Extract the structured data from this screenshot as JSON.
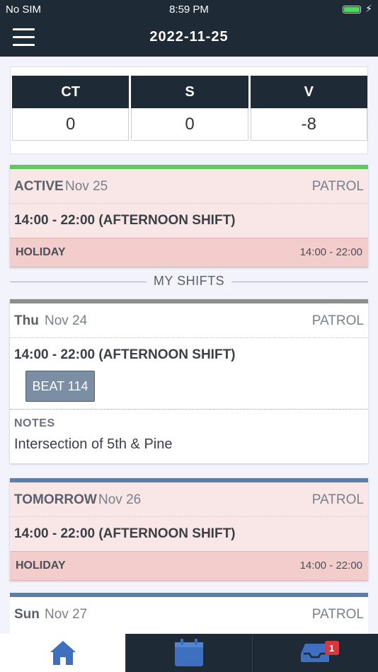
{
  "status_bar": {
    "carrier": "No SIM",
    "time": "8:59 PM"
  },
  "header": {
    "title": "2022-11-25"
  },
  "summary": [
    {
      "label": "CT",
      "value": "0"
    },
    {
      "label": "S",
      "value": "0"
    },
    {
      "label": "V",
      "value": "-8"
    }
  ],
  "active_card": {
    "status": "ACTIVE",
    "date": "Nov 25",
    "role": "PATROL",
    "shift": "14:00 - 22:00 (AFTERNOON SHIFT)",
    "holiday_label": "HOLIDAY",
    "holiday_time": "14:00 - 22:00",
    "accent": "#5ec95e"
  },
  "divider_label": "MY SHIFTS",
  "shifts": [
    {
      "day": "Thu",
      "date": "Nov 24",
      "role": "PATROL",
      "shift": "14:00 - 22:00 (AFTERNOON SHIFT)",
      "beat": "BEAT 114",
      "notes_label": "NOTES",
      "notes": "Intersection of 5th & Pine",
      "accent": "#8e8e8e"
    },
    {
      "day": "TOMORROW",
      "date": "Nov 26",
      "role": "PATROL",
      "shift": "14:00 - 22:00 (AFTERNOON SHIFT)",
      "holiday_label": "HOLIDAY",
      "holiday_time": "14:00 - 22:00",
      "accent": "#5d7fa6"
    },
    {
      "day": "Sun",
      "date": "Nov 27",
      "role": "PATROL",
      "accent": "#5d7fa6"
    }
  ],
  "tabbar": {
    "tabs": [
      {
        "icon": "home-icon"
      },
      {
        "icon": "calendar-icon"
      },
      {
        "icon": "inbox-icon",
        "badge": "1"
      }
    ],
    "accent": "#3f6fbf"
  }
}
